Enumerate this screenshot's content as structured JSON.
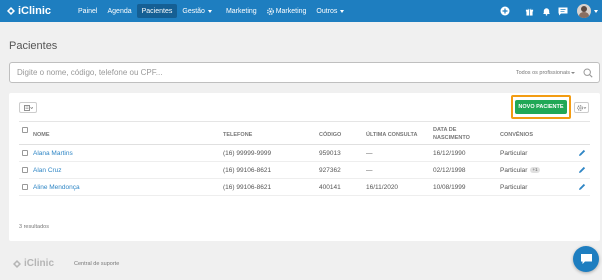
{
  "app": {
    "logo_text": "iClinic",
    "brand_color": "#1e7ec0"
  },
  "nav": {
    "items": [
      {
        "label": "Painel"
      },
      {
        "label": "Agenda"
      },
      {
        "label": "Pacientes",
        "active": true
      },
      {
        "label": "Gestão",
        "dropdown": true
      },
      {
        "label": "Marketing"
      },
      {
        "label": "Marketing",
        "icon": "gear-icon"
      },
      {
        "label": "Outros",
        "dropdown": true
      }
    ],
    "right_icons": [
      "plus-circle-icon",
      "gift-icon",
      "bell-icon",
      "chat-icon",
      "avatar"
    ]
  },
  "page": {
    "title": "Pacientes"
  },
  "search": {
    "placeholder": "Digite o nome, código, telefone ou CPF...",
    "filter_label": "Todos os profissionais"
  },
  "toolbar": {
    "new_patient_label": "NOVO PACIENTE",
    "highlight_color": "#f39c12",
    "button_color": "#21a856"
  },
  "table": {
    "headers": {
      "name": "NOME",
      "phone": "TELEFONE",
      "code": "CÓDIGO",
      "last_visit": "ÚLTIMA CONSULTA",
      "birth_line1": "DATA DE",
      "birth_line2": "NASCIMENTO",
      "insurance": "CONVÊNIOS"
    },
    "rows": [
      {
        "name": "Alana Martins",
        "phone": "(16) 99999-9999",
        "code": "959013",
        "last_visit": "—",
        "birth": "16/12/1990",
        "insurance": "Particular",
        "badge": ""
      },
      {
        "name": "Alan Cruz",
        "phone": "(16) 99106-8621",
        "code": "927362",
        "last_visit": "—",
        "birth": "02/12/1998",
        "insurance": "Particular",
        "badge": "+1"
      },
      {
        "name": "Aline Mendonça",
        "phone": "(16) 99106-8621",
        "code": "400141",
        "last_visit": "16/11/2020",
        "birth": "10/08/1999",
        "insurance": "Particular",
        "badge": ""
      }
    ],
    "results_text": "3 resultados"
  },
  "footer": {
    "logo_text": "iClinic",
    "support_link": "Central de suporte"
  }
}
